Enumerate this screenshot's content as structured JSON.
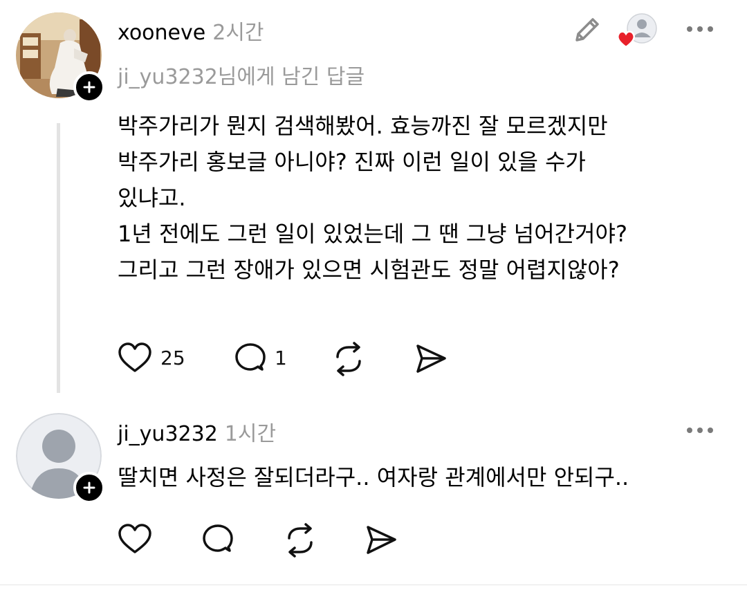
{
  "comments": [
    {
      "username": "xooneve",
      "time": "2시간",
      "reply_to": "ji_yu3232님에게 남긴 답글",
      "body_lines": [
        "박주가리가 뭔지 검색해봤어. 효능까진 잘 모르겠지만",
        "박주가리 홍보글 아니야? 진짜 이런 일이 있을 수가",
        "있냐고.",
        "1년 전에도 그런 일이 있었는데 그 땐 그냥 넘어간거야?",
        "그리고 그런 장애가 있으면 시험관도 정말 어렵지않아?"
      ],
      "like_count": "25",
      "reply_count": "1"
    },
    {
      "username": "ji_yu3232",
      "time": "1시간",
      "body_lines": [
        "딸치면 사정은 잘되더라구.. 여자랑 관계에서만 안되구.."
      ]
    }
  ],
  "colors": {
    "heart_badge": "#e8202a",
    "muted_text": "#9a9a9a",
    "avatar_default_bg": "#eceef2",
    "avatar_default_fg": "#9ea4ad"
  }
}
